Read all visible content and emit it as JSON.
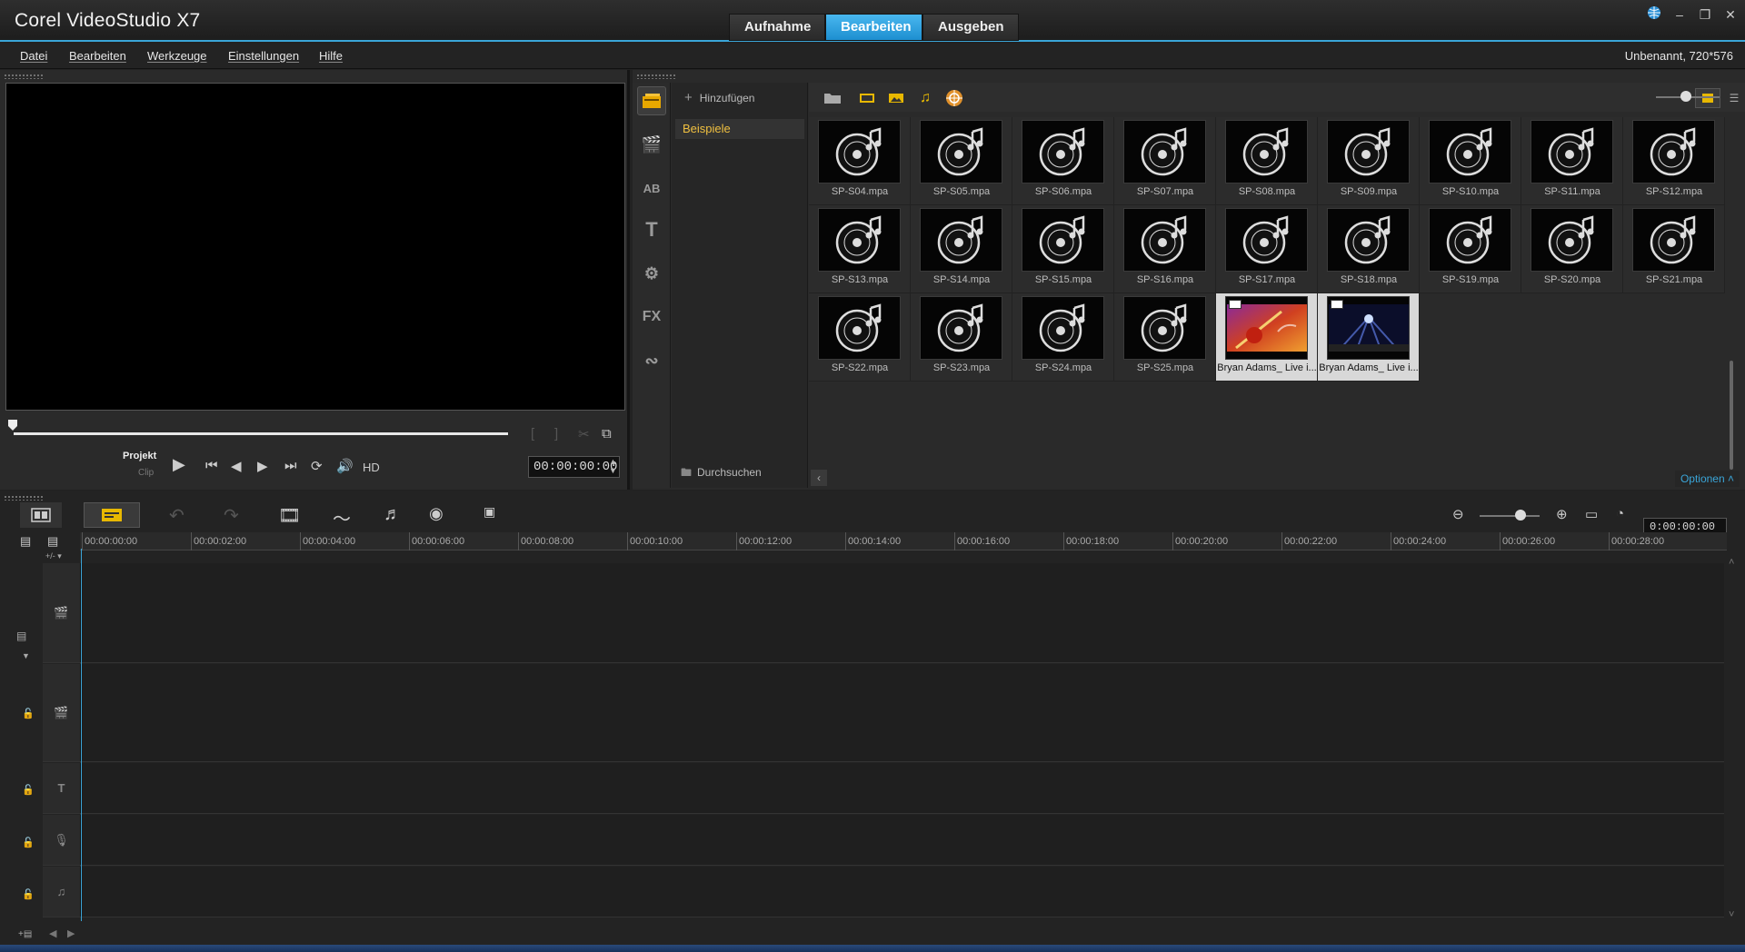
{
  "app": {
    "title": "Corel VideoStudio X7",
    "project_info": "Unbenannt, 720*576"
  },
  "mode_tabs": [
    {
      "label": "Aufnahme",
      "active": false
    },
    {
      "label": "Bearbeiten",
      "active": true
    },
    {
      "label": "Ausgeben",
      "active": false
    }
  ],
  "menu": [
    "Datei",
    "Bearbeiten",
    "Werkzeuge",
    "Einstellungen",
    "Hilfe"
  ],
  "player": {
    "mode_project": "Projekt",
    "mode_clip": "Clip",
    "hd_label": "HD",
    "timecode": "00:00:00:00"
  },
  "library": {
    "add_label": "Hinzufügen",
    "folder": "Beispiele",
    "browse_label": "Durchsuchen",
    "options_label": "Optionen",
    "items": [
      {
        "name": "SP-S04.mpa",
        "kind": "audio"
      },
      {
        "name": "SP-S05.mpa",
        "kind": "audio"
      },
      {
        "name": "SP-S06.mpa",
        "kind": "audio"
      },
      {
        "name": "SP-S07.mpa",
        "kind": "audio"
      },
      {
        "name": "SP-S08.mpa",
        "kind": "audio"
      },
      {
        "name": "SP-S09.mpa",
        "kind": "audio"
      },
      {
        "name": "SP-S10.mpa",
        "kind": "audio"
      },
      {
        "name": "SP-S11.mpa",
        "kind": "audio"
      },
      {
        "name": "SP-S12.mpa",
        "kind": "audio"
      },
      {
        "name": "SP-S13.mpa",
        "kind": "audio"
      },
      {
        "name": "SP-S14.mpa",
        "kind": "audio"
      },
      {
        "name": "SP-S15.mpa",
        "kind": "audio"
      },
      {
        "name": "SP-S16.mpa",
        "kind": "audio"
      },
      {
        "name": "SP-S17.mpa",
        "kind": "audio"
      },
      {
        "name": "SP-S18.mpa",
        "kind": "audio"
      },
      {
        "name": "SP-S19.mpa",
        "kind": "audio"
      },
      {
        "name": "SP-S20.mpa",
        "kind": "audio"
      },
      {
        "name": "SP-S21.mpa",
        "kind": "audio"
      },
      {
        "name": "SP-S22.mpa",
        "kind": "audio"
      },
      {
        "name": "SP-S23.mpa",
        "kind": "audio"
      },
      {
        "name": "SP-S24.mpa",
        "kind": "audio"
      },
      {
        "name": "SP-S25.mpa",
        "kind": "audio"
      },
      {
        "name": "Bryan Adams_ Live i...",
        "kind": "video-guitar"
      },
      {
        "name": "Bryan Adams_ Live i...",
        "kind": "video-stage"
      }
    ]
  },
  "timeline": {
    "timecode": "0:00:00:00",
    "ruler": [
      "00:00:00:00",
      "00:00:02:00",
      "00:00:04:00",
      "00:00:06:00",
      "00:00:08:00",
      "00:00:10:00",
      "00:00:12:00",
      "00:00:14:00",
      "00:00:16:00",
      "00:00:18:00",
      "00:00:20:00",
      "00:00:22:00",
      "00:00:24:00",
      "00:00:26:00",
      "00:00:28:00"
    ],
    "tracks": [
      "video-track-icon",
      "overlay-track-icon",
      "title-track-icon",
      "voice-track-icon",
      "music-track-icon"
    ]
  },
  "colors": {
    "accent": "#3aa5d8",
    "highlight": "#f0c040"
  }
}
